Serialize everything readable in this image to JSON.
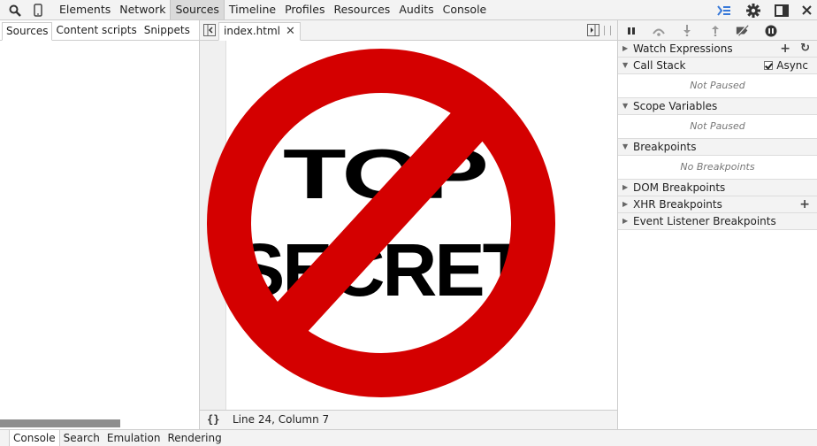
{
  "toolbar": {
    "tabs": [
      {
        "label": "Elements",
        "active": false
      },
      {
        "label": "Network",
        "active": false
      },
      {
        "label": "Sources",
        "active": true
      },
      {
        "label": "Timeline",
        "active": false
      },
      {
        "label": "Profiles",
        "active": false
      },
      {
        "label": "Resources",
        "active": false
      },
      {
        "label": "Audits",
        "active": false
      },
      {
        "label": "Console",
        "active": false
      }
    ],
    "icons": [
      "search-icon",
      "device-mode-icon",
      "console-drawer-icon",
      "settings-gear-icon",
      "dock-side-icon",
      "close-icon"
    ],
    "accent_color": "#3879d9"
  },
  "navigator": {
    "tabs": [
      {
        "label": "Sources",
        "active": true
      },
      {
        "label": "Content scripts",
        "active": false
      },
      {
        "label": "Snippets",
        "active": false
      }
    ]
  },
  "editor": {
    "open_file": "index.html",
    "status": "Line 24, Column 7",
    "pretty_print_label": "{}"
  },
  "sidebar": {
    "panes": {
      "watch": {
        "title": "Watch Expressions"
      },
      "callstack": {
        "title": "Call Stack",
        "async_label": "Async",
        "body": "Not Paused"
      },
      "scope": {
        "title": "Scope Variables",
        "body": "Not Paused"
      },
      "breakpoints": {
        "title": "Breakpoints",
        "body": "No Breakpoints"
      },
      "dom": {
        "title": "DOM Breakpoints"
      },
      "xhr": {
        "title": "XHR Breakpoints"
      },
      "events": {
        "title": "Event Listener Breakpoints"
      }
    }
  },
  "drawer": {
    "tabs": [
      {
        "label": "Console",
        "active": true
      },
      {
        "label": "Search",
        "active": false
      },
      {
        "label": "Emulation",
        "active": false
      },
      {
        "label": "Rendering",
        "active": false
      }
    ]
  },
  "overlay": {
    "line1": "TOP",
    "line2": "SECRET",
    "sign_color": "#d40000"
  }
}
